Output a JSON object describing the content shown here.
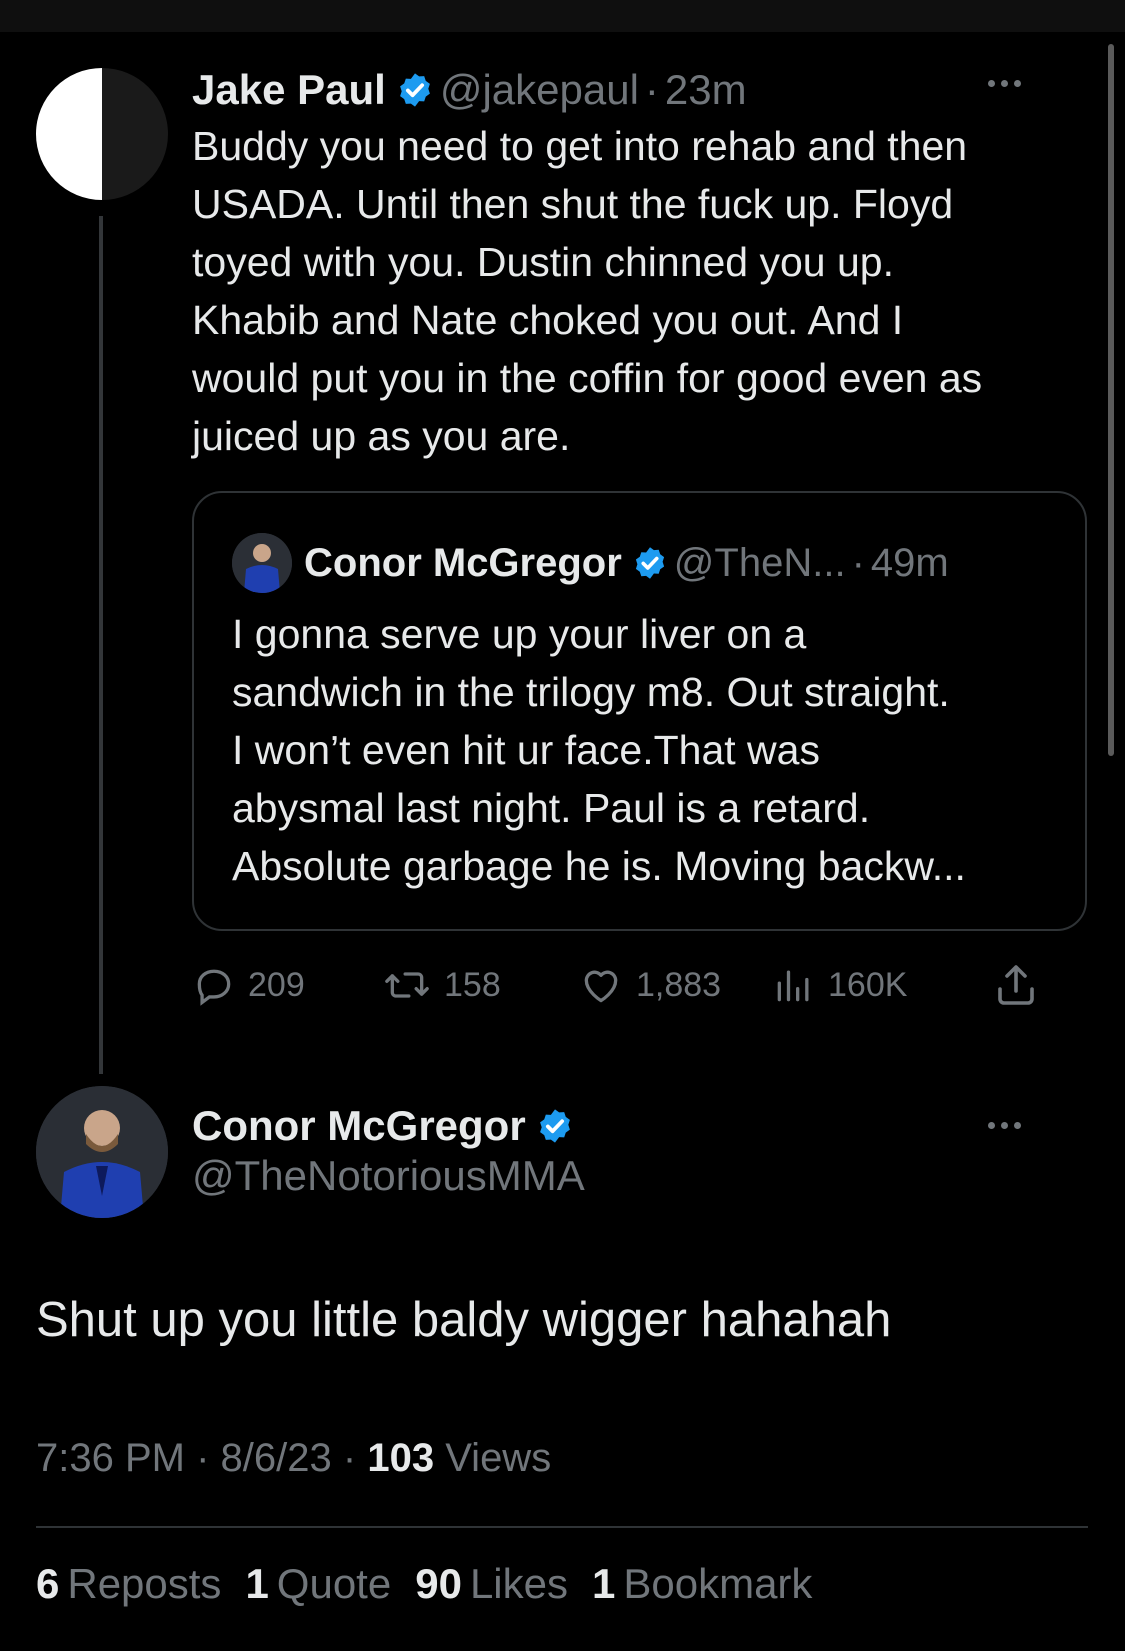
{
  "parent_tweet": {
    "author_name": "Jake Paul",
    "handle": "@jakepaul",
    "separator": "·",
    "time": "23m",
    "text": "Buddy you need to get into rehab and then\nUSADA. Until then shut the fuck up. Floyd\ntoyed with you. Dustin chinned you up.\nKhabib and Nate choked you out. And I\nwould put you in the coffin for good even as\njuiced up as you are.",
    "quoted": {
      "author_name": "Conor McGregor",
      "handle": "@TheN...",
      "separator": "·",
      "time": "49m",
      "text": "I gonna serve up your liver on a\nsandwich in the trilogy m8. Out straight.\nI won’t even hit ur face.That was\nabysmal last night. Paul is a retard.\nAbsolute garbage he is. Moving backw..."
    },
    "actions": {
      "replies": "209",
      "reposts": "158",
      "likes": "1,883",
      "views": "160K"
    }
  },
  "main_tweet": {
    "author_name": "Conor McGregor",
    "handle": "@TheNotoriousMMA",
    "text": "Shut up you little baldy wigger hahahah",
    "time": "7:36 PM",
    "date": "8/6/23",
    "sep": "·",
    "views_count": "103",
    "views_label": "Views",
    "stats": {
      "reposts_count": "6",
      "reposts_label": "Reposts",
      "quotes_count": "1",
      "quotes_label": "Quote",
      "likes_count": "90",
      "likes_label": "Likes",
      "bookmarks_count": "1",
      "bookmarks_label": "Bookmark"
    }
  },
  "colors": {
    "background": "#000000",
    "text": "#e7e9ea",
    "muted": "#71767b",
    "verified": "#1d9bf0",
    "border": "#2f3336"
  },
  "icons": [
    "verified-badge-icon",
    "more-icon",
    "reply-icon",
    "repost-icon",
    "like-icon",
    "views-icon",
    "share-icon"
  ]
}
